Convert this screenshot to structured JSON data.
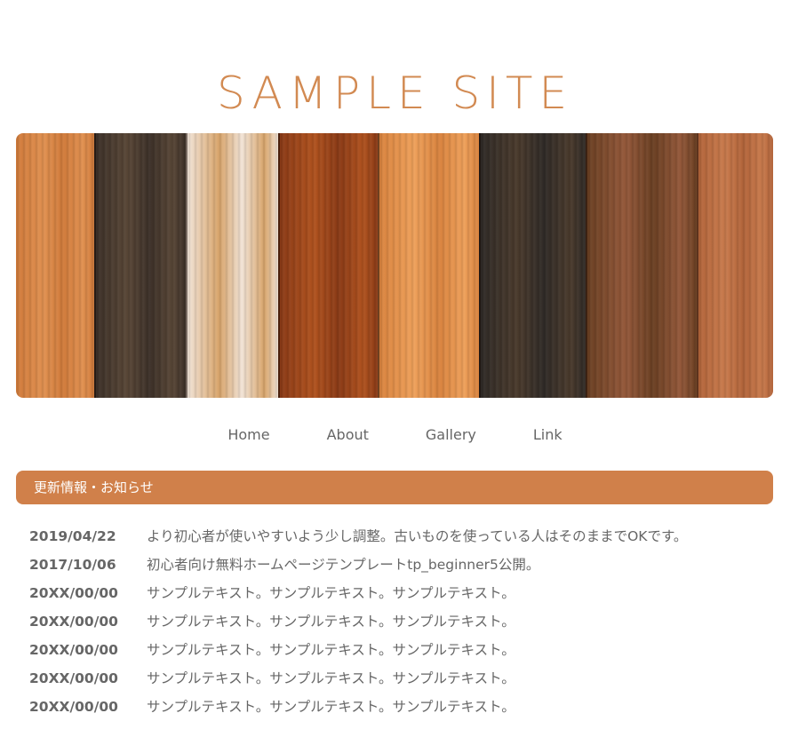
{
  "header": {
    "site_title": "SAMPLE SITE"
  },
  "hero": {
    "planks": [
      {
        "color": "#d07a3a",
        "highlight": "#e09050"
      },
      {
        "color": "#3c3028",
        "highlight": "#584636"
      },
      {
        "color": "#f1e3d6",
        "highlight": "#d8a46a"
      },
      {
        "color": "#8a3a16",
        "highlight": "#b0521e"
      },
      {
        "color": "#d9833e",
        "highlight": "#eea05a"
      },
      {
        "color": "#2f2a26",
        "highlight": "#4a3a2c"
      },
      {
        "color": "#6a3f22",
        "highlight": "#94583a"
      },
      {
        "color": "#b2643a",
        "highlight": "#c87a4c"
      }
    ]
  },
  "nav": {
    "items": [
      {
        "label": "Home"
      },
      {
        "label": "About"
      },
      {
        "label": "Gallery"
      },
      {
        "label": "Link"
      }
    ]
  },
  "news": {
    "heading": "更新情報・お知らせ",
    "items": [
      {
        "date": "2019/04/22",
        "text": "より初心者が使いやすいよう少し調整。古いものを使っている人はそのままでOKです。"
      },
      {
        "date": "2017/10/06",
        "text": "初心者向け無料ホームページテンプレートtp_beginner5公開。"
      },
      {
        "date": "20XX/00/00",
        "text": "サンプルテキスト。サンプルテキスト。サンプルテキスト。"
      },
      {
        "date": "20XX/00/00",
        "text": "サンプルテキスト。サンプルテキスト。サンプルテキスト。"
      },
      {
        "date": "20XX/00/00",
        "text": "サンプルテキスト。サンプルテキスト。サンプルテキスト。"
      },
      {
        "date": "20XX/00/00",
        "text": "サンプルテキスト。サンプルテキスト。サンプルテキスト。"
      },
      {
        "date": "20XX/00/00",
        "text": "サンプルテキスト。サンプルテキスト。サンプルテキスト。"
      }
    ]
  },
  "colors": {
    "accent": "#d0804a",
    "title": "#d28a52",
    "text": "#666666"
  }
}
